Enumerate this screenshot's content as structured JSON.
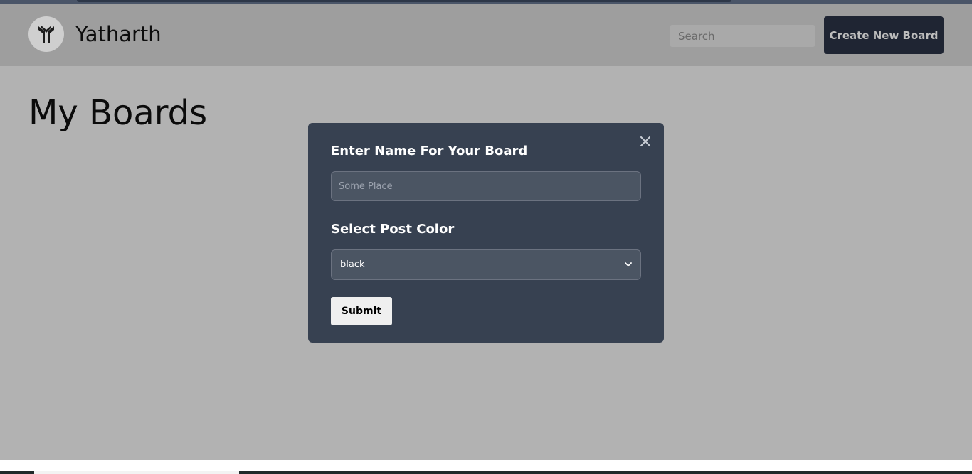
{
  "header": {
    "brand_name": "Yatharth",
    "search_placeholder": "Search",
    "create_button_label": "Create New Board"
  },
  "main": {
    "page_title": "My Boards"
  },
  "modal": {
    "name_label": "Enter Name For Your Board",
    "name_placeholder": "Some Place",
    "color_label": "Select Post Color",
    "color_selected": "black",
    "submit_label": "Submit",
    "close_icon": "close-icon"
  },
  "colors": {
    "header_bg": "#9e9e9e",
    "page_bg": "#b2b2b2",
    "modal_bg": "#374151",
    "button_dark": "#1f2533"
  }
}
